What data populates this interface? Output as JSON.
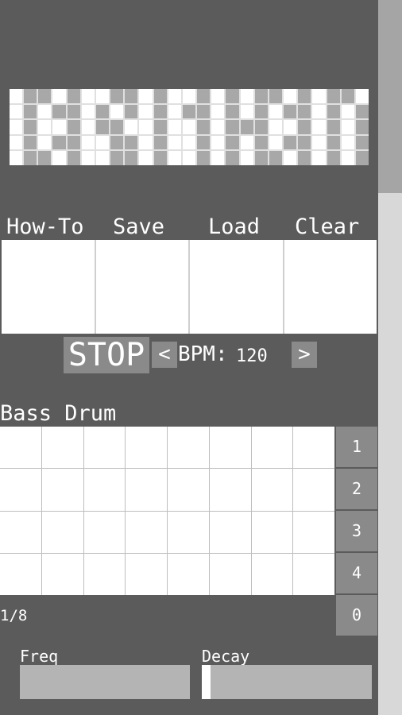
{
  "logo": {
    "description": "pixel-art wordmark",
    "grid": [
      [
        0,
        1,
        1,
        0,
        1,
        0,
        0,
        1,
        1,
        0,
        1,
        0,
        0,
        1,
        0,
        1,
        0,
        1,
        1,
        0,
        1,
        0,
        1,
        1,
        0
      ],
      [
        0,
        1,
        0,
        1,
        1,
        0,
        1,
        0,
        1,
        0,
        1,
        0,
        1,
        1,
        0,
        1,
        0,
        1,
        0,
        1,
        1,
        0,
        1,
        0,
        1
      ],
      [
        0,
        1,
        0,
        0,
        1,
        0,
        1,
        1,
        0,
        0,
        1,
        0,
        0,
        1,
        0,
        1,
        1,
        1,
        0,
        0,
        1,
        0,
        1,
        0,
        1
      ],
      [
        0,
        1,
        0,
        1,
        1,
        0,
        0,
        1,
        1,
        0,
        1,
        0,
        0,
        1,
        0,
        1,
        0,
        1,
        0,
        1,
        1,
        0,
        1,
        0,
        1
      ],
      [
        0,
        1,
        1,
        0,
        1,
        0,
        0,
        1,
        1,
        0,
        1,
        0,
        0,
        1,
        0,
        1,
        0,
        1,
        1,
        0,
        1,
        0,
        1,
        0,
        1
      ]
    ]
  },
  "top_buttons": [
    {
      "label": "How-To"
    },
    {
      "label": "Save"
    },
    {
      "label": "Load"
    },
    {
      "label": "Clear"
    }
  ],
  "transport": {
    "stop_label": "STOP",
    "prev_label": "<",
    "bpm_label": "BPM:",
    "bpm_value": "120",
    "next_label": ">"
  },
  "instrument": {
    "title": "Bass Drum",
    "steps": 8,
    "rows": 4,
    "row_buttons": [
      "1",
      "2",
      "3",
      "4",
      "0"
    ],
    "division": "1/8"
  },
  "sliders": {
    "freq": {
      "label": "Freq",
      "value_fraction": 0.0
    },
    "decay": {
      "label": "Decay",
      "value_fraction": 0.05
    }
  },
  "scrollbar": {
    "thumb_fraction": 0.27
  }
}
